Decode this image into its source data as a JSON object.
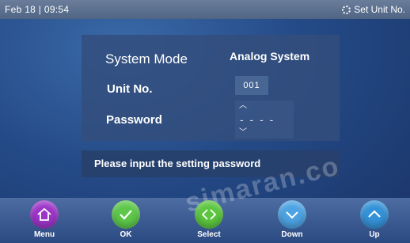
{
  "header": {
    "date_time": "Feb 18 | 09:54",
    "right_title": "Set Unit No."
  },
  "form": {
    "system_mode_label": "System Mode",
    "system_mode_value": "Analog System",
    "unit_no_label": "Unit No.",
    "unit_no_value": "001",
    "password_label": "Password",
    "password_value": "- - - -"
  },
  "message": "Please input the setting password",
  "buttons": {
    "menu": "Menu",
    "ok": "OK",
    "select": "Select",
    "down": "Down",
    "up": "Up"
  },
  "colors": {
    "menu": "#9d35c9",
    "ok": "#5dc84a",
    "select": "#5cc63e",
    "down": "#4da3e3",
    "up": "#3592d8"
  },
  "icons": {
    "menu": "home-icon",
    "ok": "check-icon",
    "select": "diamond-arrows-icon",
    "down": "chevron-down-icon",
    "up": "chevron-up-icon"
  },
  "watermark": "simaran.co"
}
